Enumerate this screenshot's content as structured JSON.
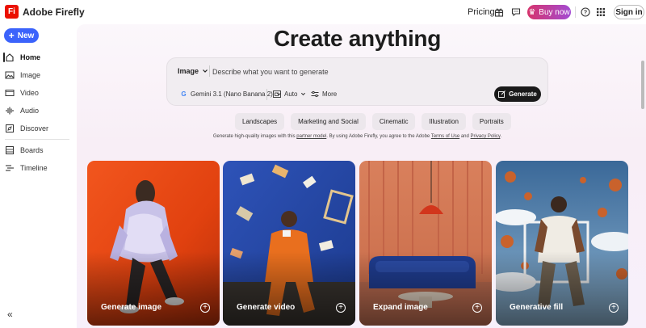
{
  "app": {
    "logo_text": "Fi",
    "title": "Adobe Firefly"
  },
  "header": {
    "pricing_label": "Pricing",
    "gift_icon": "gift-icon",
    "chat_icon": "chat-icon",
    "buy_now_label": "Buy now",
    "help_icon": "help-icon",
    "apps_icon": "apps-grid-icon",
    "sign_in_label": "Sign in"
  },
  "sidebar": {
    "new_label": "New",
    "items": [
      {
        "label": "Home",
        "icon": "home-icon",
        "active": true
      },
      {
        "label": "Image",
        "icon": "image-icon"
      },
      {
        "label": "Video",
        "icon": "video-icon"
      },
      {
        "label": "Audio",
        "icon": "audio-icon"
      },
      {
        "label": "Discover",
        "icon": "discover-icon"
      },
      {
        "label": "Boards",
        "icon": "boards-icon"
      },
      {
        "label": "Timeline",
        "icon": "timeline-icon"
      }
    ],
    "collapse_icon": "collapse-icon"
  },
  "main": {
    "headline": "Create anything",
    "prompt": {
      "mode": "Image",
      "placeholder": "Describe what you want to generate",
      "model": "Gemini 3.1 (Nano Banana 2)",
      "aspect": "Auto",
      "more": "More",
      "generate_label": "Generate"
    },
    "chips": [
      "Landscapes",
      "Marketing and Social",
      "Cinematic",
      "Illustration",
      "Portraits"
    ],
    "legal": {
      "part1": "Generate high-quality images with this ",
      "link1": "partner model",
      "part2": ". By using Adobe Firefly, you agree to the Adobe ",
      "link2": "Terms of Use",
      "part3": " and ",
      "link3": "Privacy Policy",
      "part4": "."
    },
    "cards": [
      {
        "label": "Generate image"
      },
      {
        "label": "Generate video"
      },
      {
        "label": "Expand image"
      },
      {
        "label": "Generative fill"
      }
    ]
  },
  "colors": {
    "accent": "#3b63fb",
    "logo": "#eb1000",
    "buy_now_start": "#d6336c",
    "buy_now_end": "#a34bd3"
  }
}
